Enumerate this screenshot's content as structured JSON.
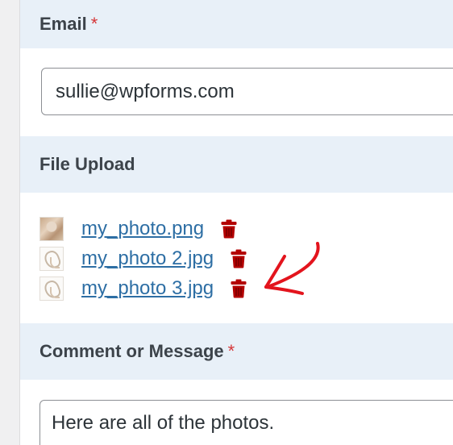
{
  "form": {
    "email": {
      "label": "Email",
      "required_mark": "*",
      "value": "sullie@wpforms.com"
    },
    "file_upload": {
      "label": "File Upload",
      "files": [
        {
          "name": "my_photo.png",
          "thumbnail": "photo-thumbnail",
          "delete_icon": "trash-icon"
        },
        {
          "name": "my_photo 2.jpg",
          "thumbnail": "sketch-thumbnail",
          "delete_icon": "trash-icon"
        },
        {
          "name": "my_photo 3.jpg",
          "thumbnail": "sketch-thumbnail",
          "delete_icon": "trash-icon"
        }
      ]
    },
    "comment": {
      "label": "Comment or Message",
      "required_mark": "*",
      "value": "Here are all of the photos."
    }
  },
  "colors": {
    "section_bg": "#e8f0f8",
    "required": "#d63638",
    "link": "#2d6ea4",
    "trash": "#b30000",
    "annotation_arrow": "#e3141d"
  },
  "annotation": {
    "icon": "curved-arrow-icon"
  }
}
